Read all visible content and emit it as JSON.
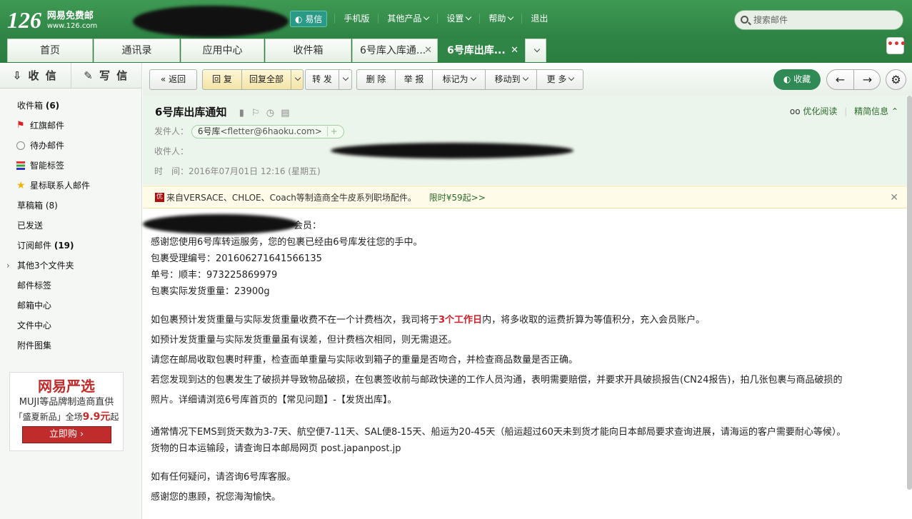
{
  "header": {
    "logo_number": "126",
    "logo_title": "网易免费邮",
    "logo_url": "www.126.com",
    "nav": {
      "yixin": "易信",
      "items": [
        "手机版",
        "其他产品",
        "设置",
        "帮助",
        "退出"
      ]
    },
    "search_placeholder": "搜索邮件"
  },
  "tabs": [
    {
      "label": "首页"
    },
    {
      "label": "通讯录"
    },
    {
      "label": "应用中心"
    },
    {
      "label": "收件箱"
    },
    {
      "label": "6号库入库通..."
    },
    {
      "label": "6号库出库..."
    }
  ],
  "sidebar": {
    "receive": "收 信",
    "compose": "写 信",
    "folders": [
      {
        "label": "收件箱",
        "count": "(6)"
      },
      {
        "label": "红旗邮件"
      },
      {
        "label": "待办邮件"
      },
      {
        "label": "智能标签"
      },
      {
        "label": "星标联系人邮件"
      },
      {
        "label": "草稿箱",
        "count": "(8)"
      },
      {
        "label": "已发送"
      },
      {
        "label": "订阅邮件",
        "count": "(19)"
      },
      {
        "label": "其他3个文件夹"
      },
      {
        "label": "邮件标签"
      },
      {
        "label": "邮箱中心"
      },
      {
        "label": "文件中心"
      },
      {
        "label": "附件图集"
      }
    ],
    "ad": {
      "brand": "网易严选",
      "line1": "MUJI等品牌制造商直供",
      "line2_pre": "「盛夏新品」全场",
      "line2_price": "9.9元",
      "line2_post": "起",
      "button": "立即购"
    }
  },
  "toolbar": {
    "back": "返回",
    "reply": "回 复",
    "reply_all": "回复全部",
    "forward": "转 发",
    "delete": "删 除",
    "report": "举 报",
    "mark": "标记为",
    "move": "移动到",
    "more": "更 多",
    "collect": "收藏"
  },
  "mail": {
    "subject": "6号库出库通知",
    "from_label": "发件人：",
    "from_name": "6号库",
    "from_email": "<fletter@6haoku.com>",
    "to_label": "收件人：",
    "time_label": "时　间：",
    "time_value": "2016年07月01日 12:16 (星期五)",
    "optimize_read": "优化阅读",
    "brief_info": "精简信息"
  },
  "notice": {
    "tag": "优",
    "text": "来自VERSACE、CHLOE、Coach等制造商全牛皮系列职场配件。",
    "link": "限时¥59起>>"
  },
  "body": {
    "greeting_tail": "会员：",
    "p1": "感谢您使用6号库转运服务，您的包裹已经由6号库发往您的手中。",
    "p2": "包裹受理编号：201606271641566135",
    "p3": "单号：顺丰：973225869979",
    "p4": "包裹实际发货重量：23900g",
    "p5_pre": "如包裹预计发货重量与实际发货重量收费不在一个计费档次，我司将于",
    "p5_red": "3个工作日",
    "p5_post": "内，将多收取的运费折算为等值积分，充入会员账户。",
    "p6": "如预计发货重量与实际发货重量虽有误差，但计费档次相同，则无需退还。",
    "p7": "请您在邮局收取包裹时秤重，检查面单重量与实际收到箱子的重量是否吻合，并检查商品数量是否正确。",
    "p8a": "若您发现到达的包裹发生了破损并导致物品破损，在包裹签收前与邮政快递的工作人员沟通，表明需要赔偿，并要求开具破损报告(CN24报告)，拍几张包裹与商品破损的",
    "p8b": "照片。详细请浏览6号库首页的【常见问题】-【发货出库】。",
    "p9a": "通常情况下EMS到货天数为3-7天、航空便7-11天、SAL便8-15天、船运为20-45天（船运超过60天未到货才能向日本邮局要求查询进展，请海运的客户需要耐心等候）。",
    "p9b": "货物的日本运输段，请查询日本邮局网页 post.japanpost.jp",
    "p10": "如有任何疑问，请咨询6号库客服。",
    "p11": "感谢您的惠顾，祝您海淘愉快。"
  }
}
